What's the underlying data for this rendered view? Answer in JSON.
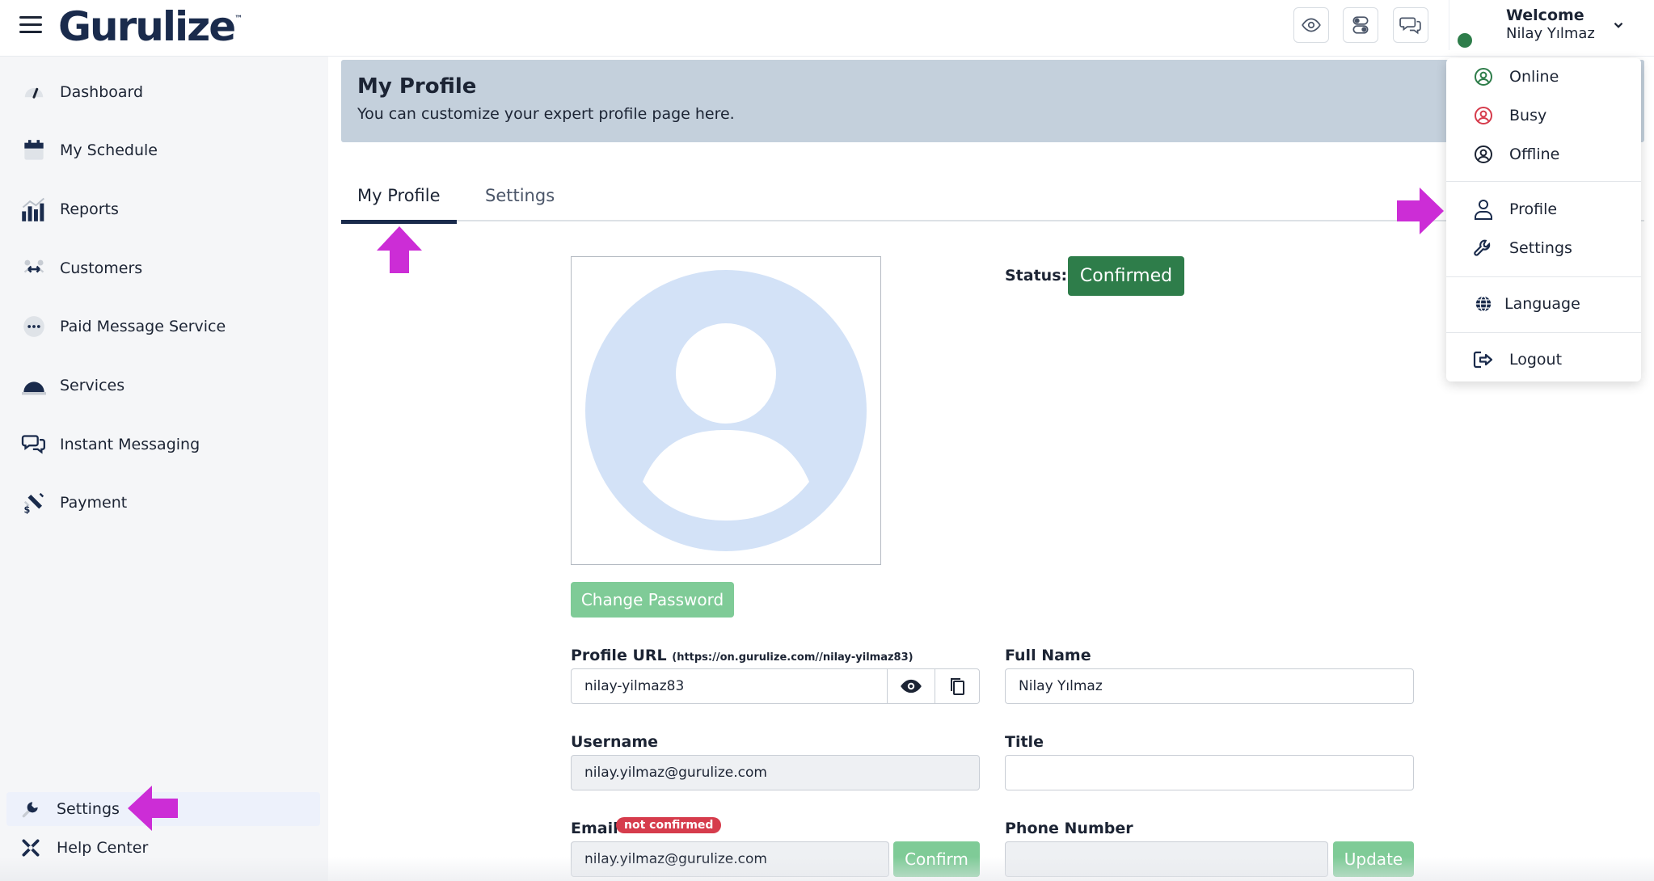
{
  "app": {
    "logo_text": "Gurulize",
    "logo_mark": "™"
  },
  "header": {
    "welcome_title": "Welcome",
    "user_name": "Nilay Yılmaz",
    "icons": [
      "eye-icon",
      "toggle-icon",
      "chat-icon"
    ]
  },
  "sidebar": {
    "items": [
      {
        "label": "Dashboard",
        "icon": "gauge-icon"
      },
      {
        "label": "My Schedule",
        "icon": "calendar-icon"
      },
      {
        "label": "Reports",
        "icon": "bar-chart-icon"
      },
      {
        "label": "Customers",
        "icon": "customers-icon"
      },
      {
        "label": "Paid Message Service",
        "icon": "message-dots-icon"
      },
      {
        "label": "Services",
        "icon": "cloche-icon"
      },
      {
        "label": "Instant Messaging",
        "icon": "chat-bubbles-icon"
      },
      {
        "label": "Payment",
        "icon": "payment-icon"
      }
    ],
    "bottom": [
      {
        "label": "Settings",
        "icon": "wrench-icon"
      },
      {
        "label": "Help Center",
        "icon": "tools-icon"
      }
    ]
  },
  "page": {
    "title": "My Profile",
    "subtitle": "You can customize your expert profile page here.",
    "tabs": [
      {
        "label": "My Profile",
        "active": true
      },
      {
        "label": "Settings",
        "active": false
      }
    ],
    "status_label": "Status:",
    "status_value": "Confirmed",
    "change_password": "Change Password"
  },
  "form": {
    "profile_url_label": "Profile URL",
    "profile_url_hint": "(https://on.gurulize.com//nilay-yilmaz83)",
    "profile_url_value": "nilay-yilmaz83",
    "full_name_label": "Full Name",
    "full_name_value": "Nilay Yılmaz",
    "username_label": "Username",
    "username_value": "nilay.yilmaz@gurulize.com",
    "title_label": "Title",
    "title_value": "",
    "email_label": "Email",
    "email_badge": "not confirmed",
    "email_value": "nilay.yilmaz@gurulize.com",
    "confirm_button": "Confirm",
    "phone_label": "Phone Number",
    "phone_value": "",
    "update_button": "Update"
  },
  "dropdown": {
    "status_items": [
      {
        "label": "Online",
        "color": "#2e7d4a"
      },
      {
        "label": "Busy",
        "color": "#d63c4c"
      },
      {
        "label": "Offline",
        "color": "#1c2434"
      }
    ],
    "items": [
      {
        "label": "Profile",
        "icon": "user-icon"
      },
      {
        "label": "Settings",
        "icon": "wrench-icon"
      },
      {
        "label": "Language",
        "icon": "globe-icon"
      },
      {
        "label": "Logout",
        "icon": "logout-icon"
      }
    ]
  },
  "colors": {
    "brand": "#1a2b4c",
    "confirmed": "#2e7d4a",
    "action_green": "#7fcb97",
    "badge_red": "#d63c4c",
    "annotation_arrow": "#cc2dd6",
    "header_panel": "#c4d0dc",
    "avatar_fill": "#d3e2f7"
  }
}
